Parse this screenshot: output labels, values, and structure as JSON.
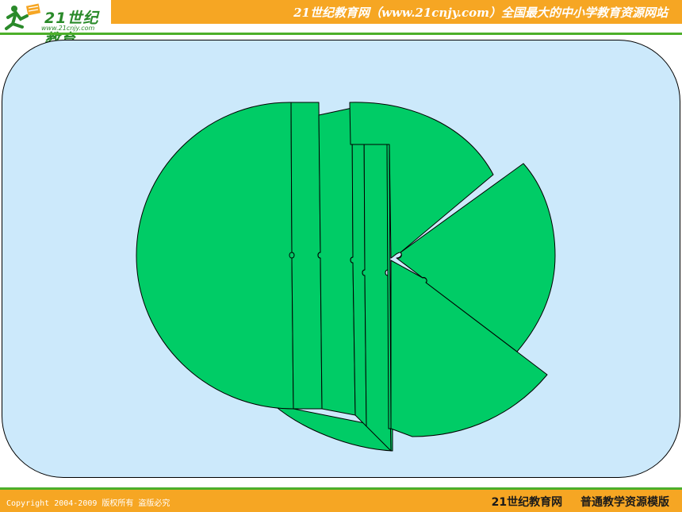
{
  "header": {
    "logo_text": "21世纪教育",
    "logo_sub": "www.21cnjy.com",
    "site_title": "21世纪教育网（www.21cnjy.com）全国最大的中小学教育资源网站"
  },
  "footer": {
    "copyright": "Copyright 2004-2009 版权所有 盗版必究",
    "brand": "21世纪教育网",
    "template_name": "普通教学资源模版"
  },
  "colors": {
    "accent_orange": "#f6a623",
    "accent_green": "#4caf2a",
    "panel_blue": "#cce9fb",
    "shape_green": "#00cc66"
  }
}
